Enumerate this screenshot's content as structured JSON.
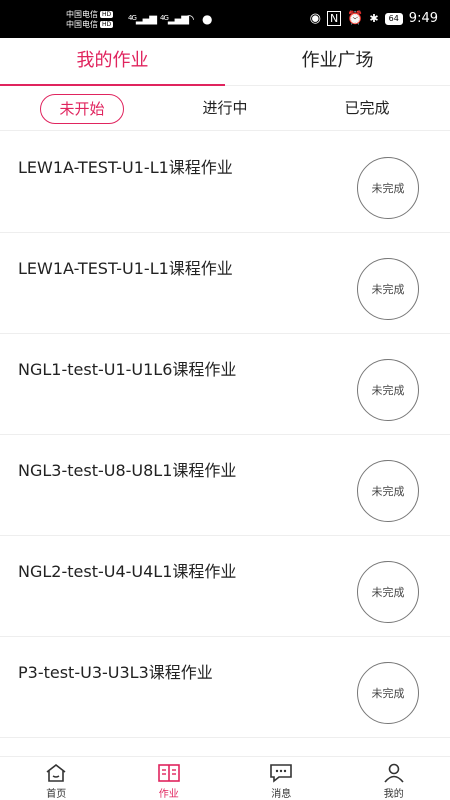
{
  "status_bar": {
    "carrier_1": "中国电信",
    "carrier_2": "中国电信",
    "hd_badge": "HD",
    "network_1": "4G",
    "network_2": "4G",
    "battery": "64",
    "time": "9:49"
  },
  "top_tabs": [
    {
      "label": "我的作业",
      "active": true
    },
    {
      "label": "作业广场",
      "active": false
    }
  ],
  "sub_tabs": [
    {
      "label": "未开始",
      "active": true
    },
    {
      "label": "进行中",
      "active": false
    },
    {
      "label": "已完成",
      "active": false
    }
  ],
  "homework_list": [
    {
      "title": "LEW1A-TEST-U1-L1课程作业",
      "status": "未完成"
    },
    {
      "title": "LEW1A-TEST-U1-L1课程作业",
      "status": "未完成"
    },
    {
      "title": "NGL1-test-U1-U1L6课程作业",
      "status": "未完成"
    },
    {
      "title": "NGL3-test-U8-U8L1课程作业",
      "status": "未完成"
    },
    {
      "title": "NGL2-test-U4-U4L1课程作业",
      "status": "未完成"
    },
    {
      "title": "P3-test-U3-U3L3课程作业",
      "status": "未完成"
    }
  ],
  "bottom_nav": [
    {
      "label": "首页",
      "icon": "home-icon",
      "active": false
    },
    {
      "label": "作业",
      "icon": "book-icon",
      "active": true
    },
    {
      "label": "消息",
      "icon": "message-icon",
      "active": false
    },
    {
      "label": "我的",
      "icon": "person-icon",
      "active": false
    }
  ],
  "colors": {
    "accent": "#e0245e",
    "divider": "#eeeeee",
    "status_bar": "#000000"
  }
}
